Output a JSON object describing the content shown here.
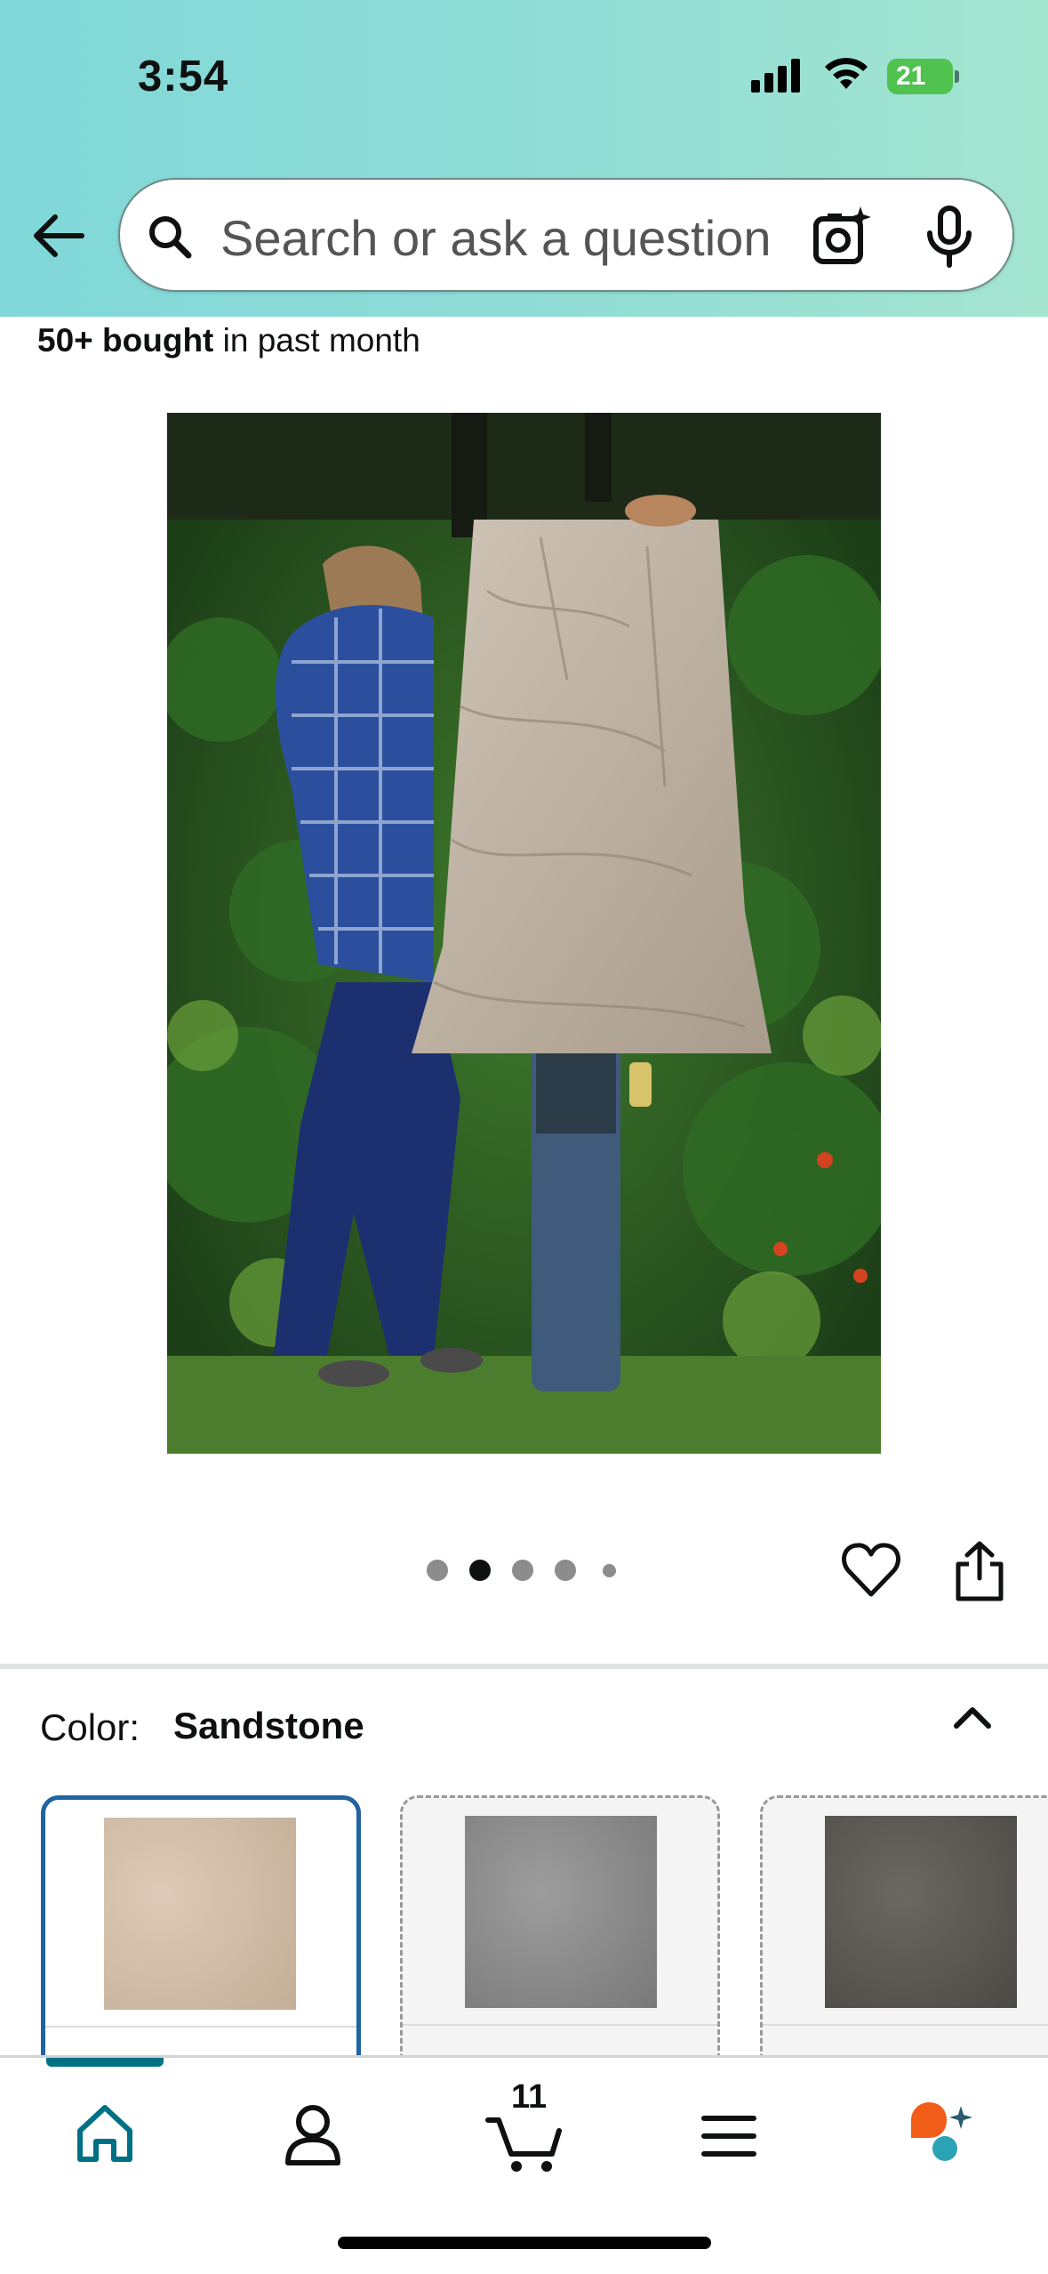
{
  "status_bar": {
    "time": "3:54",
    "battery": "21"
  },
  "search": {
    "placeholder": "Search or ask a question"
  },
  "product": {
    "bought_bold": "50+ bought",
    "bought_rest": " in past month",
    "image_count": 5,
    "current_image_index": 1
  },
  "color": {
    "label": "Color:",
    "value": "Sandstone"
  },
  "swatches": [
    {
      "name": "Sandstone",
      "selected": true,
      "color": "#cdb8a3"
    },
    {
      "name": "Gray",
      "selected": false,
      "color": "#8b8c8b"
    },
    {
      "name": "Dark",
      "selected": false,
      "color": "#5a5752"
    }
  ],
  "bottom_nav": {
    "items": [
      "home-icon",
      "account-icon",
      "cart-icon",
      "menu-icon",
      "ai-assistant-icon"
    ],
    "cart_count": "11",
    "active": "home"
  },
  "colors": {
    "accent": "#007185",
    "selected_border": "#2162a1",
    "header_start": "#80d8d8",
    "header_end": "#a4e5cf"
  }
}
